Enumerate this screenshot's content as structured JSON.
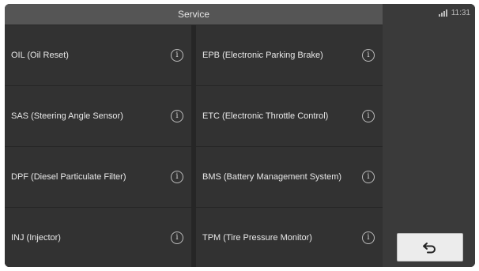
{
  "header": {
    "title": "Service"
  },
  "status": {
    "time": "11:31",
    "signal_icon": "signal-icon"
  },
  "services": [
    {
      "label": "OIL (Oil Reset)",
      "icon": "info-icon"
    },
    {
      "label": "EPB (Electronic Parking Brake)",
      "icon": "info-icon"
    },
    {
      "label": "SAS (Steering Angle Sensor)",
      "icon": "info-icon"
    },
    {
      "label": "ETC (Electronic Throttle Control)",
      "icon": "info-icon"
    },
    {
      "label": "DPF (Diesel Particulate Filter)",
      "icon": "info-icon"
    },
    {
      "label": "BMS (Battery Management System)",
      "icon": "info-icon"
    },
    {
      "label": "INJ (Injector)",
      "icon": "info-icon"
    },
    {
      "label": "TPM (Tire Pressure Monitor)",
      "icon": "info-icon"
    }
  ],
  "info_glyph": "i",
  "back_button": {
    "icon": "back-arrow-icon"
  },
  "colors": {
    "header_bg": "#555555",
    "cell_bg": "#323232",
    "panel_bg": "#3a3a3a",
    "button_bg": "#ececec"
  }
}
